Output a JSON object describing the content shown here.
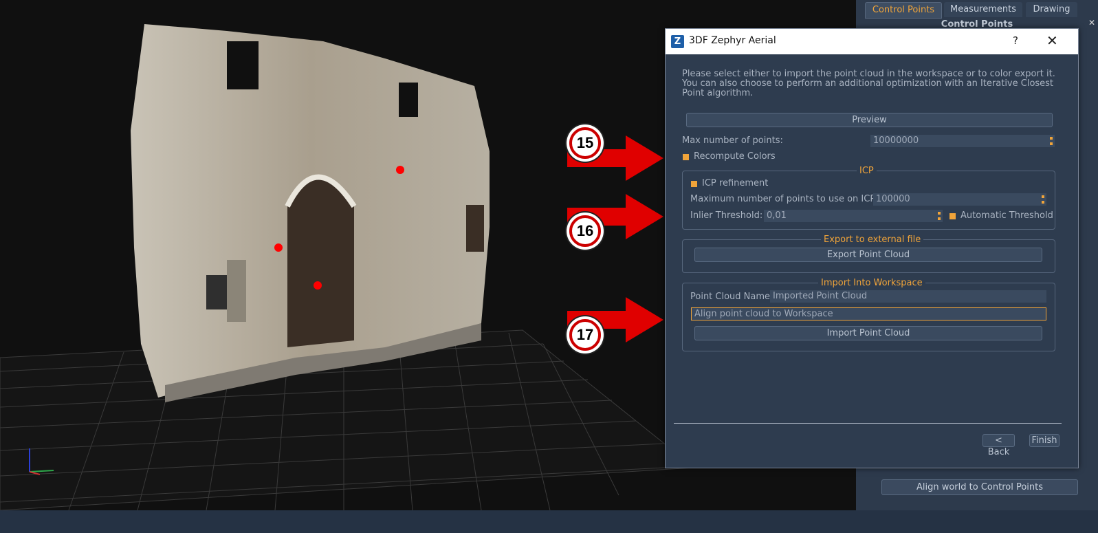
{
  "right_panel": {
    "tabs": [
      {
        "label": "Control Points",
        "active": true
      },
      {
        "label": "Measurements",
        "active": false
      },
      {
        "label": "Drawing",
        "active": false
      }
    ],
    "section_title": "Control Points",
    "close_icon": "close-icon",
    "align_button": "Align world to Control Points"
  },
  "dialog": {
    "title": "3DF Zephyr Aerial",
    "logo_letter": "Z",
    "help_label": "?",
    "close_label": "✕",
    "description": "Please select either to import the point cloud in the workspace or to color export it. You can also choose to perform an additional optimization with an Iterative Closest Point algorithm.",
    "preview_button": "Preview",
    "max_points_label": "Max number of points:",
    "max_points_value": "10000000",
    "recompute_colors_label": "Recompute Colors",
    "icp": {
      "title": "ICP",
      "refinement_label": "ICP refinement",
      "max_points_label": "Maximum number of points to use on ICP:",
      "max_points_value": "100000",
      "inlier_label": "Inlier Threshold:",
      "inlier_value": "0,01",
      "automatic_threshold_label": "Automatic Threshold"
    },
    "export": {
      "title": "Export to external file",
      "button": "Export Point Cloud"
    },
    "import": {
      "title": "Import Into Workspace",
      "name_label": "Point Cloud Name",
      "name_value": "Imported Point Cloud",
      "align_placeholder": "Align point cloud to Workspace",
      "button": "Import Point Cloud"
    },
    "back_button": "< Back",
    "finish_button": "Finish"
  },
  "markers": [
    "15",
    "16",
    "17"
  ],
  "colors": {
    "accent": "#f0a43a",
    "dialog_bg": "#2e3c4f",
    "marker_red": "#cc0000"
  }
}
